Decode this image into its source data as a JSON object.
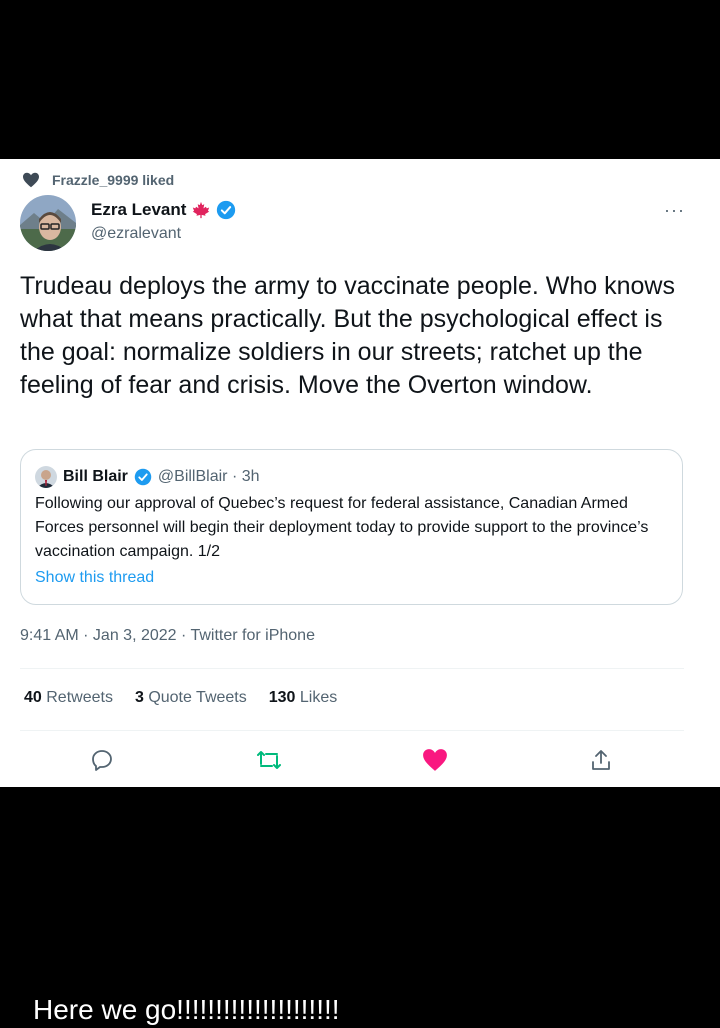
{
  "liked_by": "Frazzle_9999 liked",
  "tweet": {
    "author_name": "Ezra Levant",
    "author_handle": "@ezralevant",
    "text": "Trudeau deploys the army to vaccinate people. Who knows what that means practically. But the psychological effect is the goal: normalize soldiers in our streets; ratchet up the feeling of fear and crisis. Move the Overton window.",
    "more_icon": "···",
    "timestamp": "9:41 AM · Jan 3, 2022 · Twitter for iPhone"
  },
  "quoted": {
    "author_name": "Bill Blair",
    "author_handle": "@BillBlair · 3h",
    "text": "Following our approval of Quebec’s request for federal assistance, Canadian Armed Forces personnel will begin their deployment today to provide support to the province’s vaccination campaign.  1/2",
    "link": "Show this thread"
  },
  "stats": {
    "retweets_count": "40",
    "retweets_label": "Retweets",
    "quotes_count": "3",
    "quotes_label": "Quote Tweets",
    "likes_count": "130",
    "likes_label": "Likes"
  },
  "colors": {
    "link": "#1d9bf0",
    "retweet": "#00ba7c",
    "like": "#f91880",
    "verified": "#1d9bf0"
  },
  "caption": "Here we go!!!!!!!!!!!!!!!!!!!!!"
}
